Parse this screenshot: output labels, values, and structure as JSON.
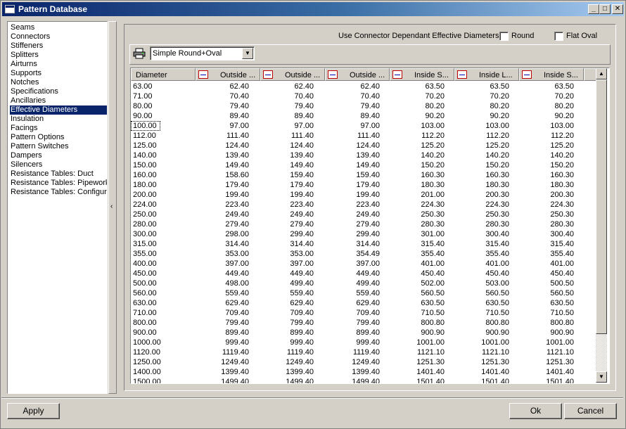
{
  "window": {
    "title": "Pattern Database"
  },
  "titlebar_buttons": {
    "minimize": "_",
    "maximize": "□",
    "close": "✕"
  },
  "sidebar": {
    "items": [
      {
        "label": "Seams"
      },
      {
        "label": "Connectors"
      },
      {
        "label": "Stiffeners"
      },
      {
        "label": "Splitters"
      },
      {
        "label": "Airturns"
      },
      {
        "label": "Supports"
      },
      {
        "label": "Notches"
      },
      {
        "label": "Specifications"
      },
      {
        "label": "Ancillaries"
      },
      {
        "label": "Effective Diameters",
        "selected": true
      },
      {
        "label": "Insulation"
      },
      {
        "label": "Facings"
      },
      {
        "label": "Pattern Options"
      },
      {
        "label": "Pattern Switches"
      },
      {
        "label": "Dampers"
      },
      {
        "label": "Silencers"
      },
      {
        "label": "Resistance Tables: Duct"
      },
      {
        "label": "Resistance Tables: Pipework"
      },
      {
        "label": "Resistance Tables: Configura"
      }
    ],
    "collapse_glyph": "‹"
  },
  "options": {
    "label": "Use Connector Dependant Effective Diameters",
    "round_label": "Round",
    "round_checked": false,
    "flat_oval_label": "Flat Oval",
    "flat_oval_checked": false
  },
  "toolbar": {
    "print_icon": "printer-icon",
    "combo_value": "Simple Round+Oval",
    "combo_arrow": "▼"
  },
  "grid": {
    "columns": [
      {
        "label": "Diameter"
      },
      {
        "label": "Outside ..."
      },
      {
        "label": "Outside ..."
      },
      {
        "label": "Outside ..."
      },
      {
        "label": "Inside S..."
      },
      {
        "label": "Inside L..."
      },
      {
        "label": "Inside S..."
      }
    ],
    "rows": [
      [
        "63.00",
        "62.40",
        "62.40",
        "62.40",
        "63.50",
        "63.50",
        "63.50"
      ],
      [
        "71.00",
        "70.40",
        "70.40",
        "70.40",
        "70.20",
        "70.20",
        "70.20"
      ],
      [
        "80.00",
        "79.40",
        "79.40",
        "79.40",
        "80.20",
        "80.20",
        "80.20"
      ],
      [
        "90.00",
        "89.40",
        "89.40",
        "89.40",
        "90.20",
        "90.20",
        "90.20"
      ],
      [
        "100.00",
        "97.00",
        "97.00",
        "97.00",
        "103.00",
        "103.00",
        "103.00"
      ],
      [
        "112.00",
        "111.40",
        "111.40",
        "111.40",
        "112.20",
        "112.20",
        "112.20"
      ],
      [
        "125.00",
        "124.40",
        "124.40",
        "124.40",
        "125.20",
        "125.20",
        "125.20"
      ],
      [
        "140.00",
        "139.40",
        "139.40",
        "139.40",
        "140.20",
        "140.20",
        "140.20"
      ],
      [
        "150.00",
        "149.40",
        "149.40",
        "149.40",
        "150.20",
        "150.20",
        "150.20"
      ],
      [
        "160.00",
        "158.60",
        "159.40",
        "159.40",
        "160.30",
        "160.30",
        "160.30"
      ],
      [
        "180.00",
        "179.40",
        "179.40",
        "179.40",
        "180.30",
        "180.30",
        "180.30"
      ],
      [
        "200.00",
        "199.40",
        "199.40",
        "199.40",
        "201.00",
        "200.30",
        "200.30"
      ],
      [
        "224.00",
        "223.40",
        "223.40",
        "223.40",
        "224.30",
        "224.30",
        "224.30"
      ],
      [
        "250.00",
        "249.40",
        "249.40",
        "249.40",
        "250.30",
        "250.30",
        "250.30"
      ],
      [
        "280.00",
        "279.40",
        "279.40",
        "279.40",
        "280.30",
        "280.30",
        "280.30"
      ],
      [
        "300.00",
        "298.00",
        "299.40",
        "299.40",
        "301.00",
        "300.40",
        "300.40"
      ],
      [
        "315.00",
        "314.40",
        "314.40",
        "314.40",
        "315.40",
        "315.40",
        "315.40"
      ],
      [
        "355.00",
        "353.00",
        "353.00",
        "354.49",
        "355.40",
        "355.40",
        "355.40"
      ],
      [
        "400.00",
        "397.00",
        "397.00",
        "397.00",
        "401.00",
        "401.00",
        "401.00"
      ],
      [
        "450.00",
        "449.40",
        "449.40",
        "449.40",
        "450.40",
        "450.40",
        "450.40"
      ],
      [
        "500.00",
        "498.00",
        "499.40",
        "499.40",
        "502.00",
        "503.00",
        "500.50"
      ],
      [
        "560.00",
        "559.40",
        "559.40",
        "559.40",
        "560.50",
        "560.50",
        "560.50"
      ],
      [
        "630.00",
        "629.40",
        "629.40",
        "629.40",
        "630.50",
        "630.50",
        "630.50"
      ],
      [
        "710.00",
        "709.40",
        "709.40",
        "709.40",
        "710.50",
        "710.50",
        "710.50"
      ],
      [
        "800.00",
        "799.40",
        "799.40",
        "799.40",
        "800.80",
        "800.80",
        "800.80"
      ],
      [
        "900.00",
        "899.40",
        "899.40",
        "899.40",
        "900.90",
        "900.90",
        "900.90"
      ],
      [
        "1000.00",
        "999.40",
        "999.40",
        "999.40",
        "1001.00",
        "1001.00",
        "1001.00"
      ],
      [
        "1120.00",
        "1119.40",
        "1119.40",
        "1119.40",
        "1121.10",
        "1121.10",
        "1121.10"
      ],
      [
        "1250.00",
        "1249.40",
        "1249.40",
        "1249.40",
        "1251.30",
        "1251.30",
        "1251.30"
      ],
      [
        "1400.00",
        "1399.40",
        "1399.40",
        "1399.40",
        "1401.40",
        "1401.40",
        "1401.40"
      ],
      [
        "1500.00",
        "1499.40",
        "1499.40",
        "1499.40",
        "1501.40",
        "1501.40",
        "1501.40"
      ]
    ],
    "focused_row": 4,
    "scroll_up": "▲",
    "scroll_down": "▼"
  },
  "buttons": {
    "apply": "Apply",
    "ok": "Ok",
    "cancel": "Cancel"
  }
}
